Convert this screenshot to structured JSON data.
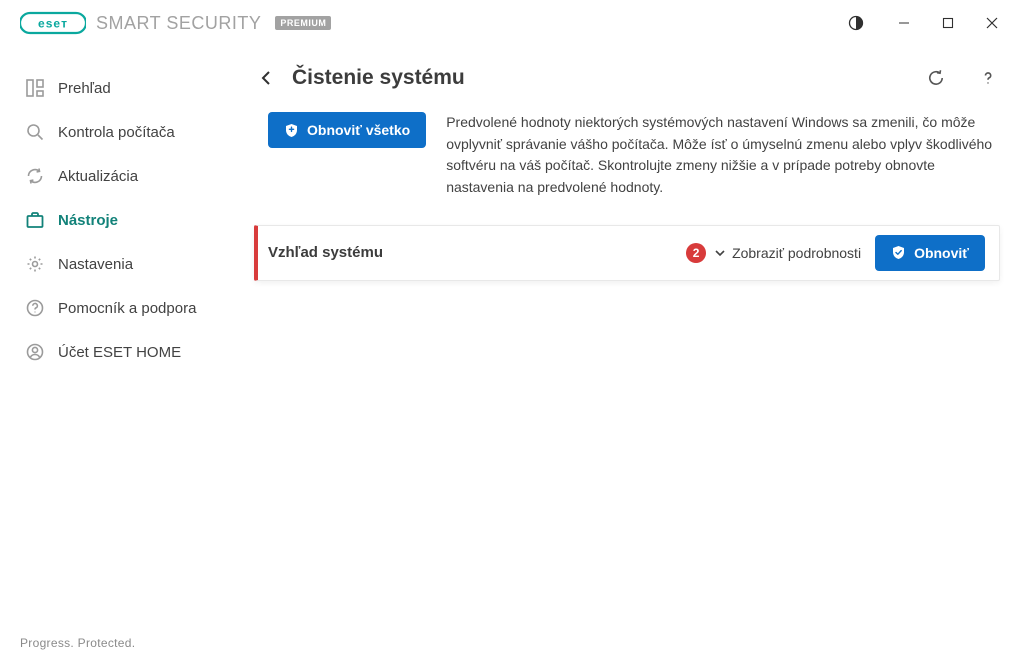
{
  "brand": {
    "product": "SMART SECURITY",
    "edition": "PREMIUM"
  },
  "sidebar": {
    "items": [
      {
        "label": "Prehľad"
      },
      {
        "label": "Kontrola počítača"
      },
      {
        "label": "Aktualizácia"
      },
      {
        "label": "Nástroje"
      },
      {
        "label": "Nastavenia"
      },
      {
        "label": "Pomocník a podpora"
      },
      {
        "label": "Účet ESET HOME"
      }
    ]
  },
  "page": {
    "title": "Čistenie systému",
    "reset_all": "Obnoviť všetko",
    "intro": "Predvolené hodnoty niektorých systémových nastavení Windows sa zmenili, čo môže ovplyvniť správanie vášho počítača. Môže ísť o úmyselnú zmenu alebo vplyv škodlivého softvéru na váš počítač. Skontrolujte zmeny nižšie a v prípade potreby obnovte nastavenia na predvolené hodnoty."
  },
  "card": {
    "title": "Vzhľad systému",
    "count": "2",
    "details": "Zobraziť podrobnosti",
    "reset": "Obnoviť"
  },
  "footer": {
    "tagline": "Progress. Protected."
  }
}
